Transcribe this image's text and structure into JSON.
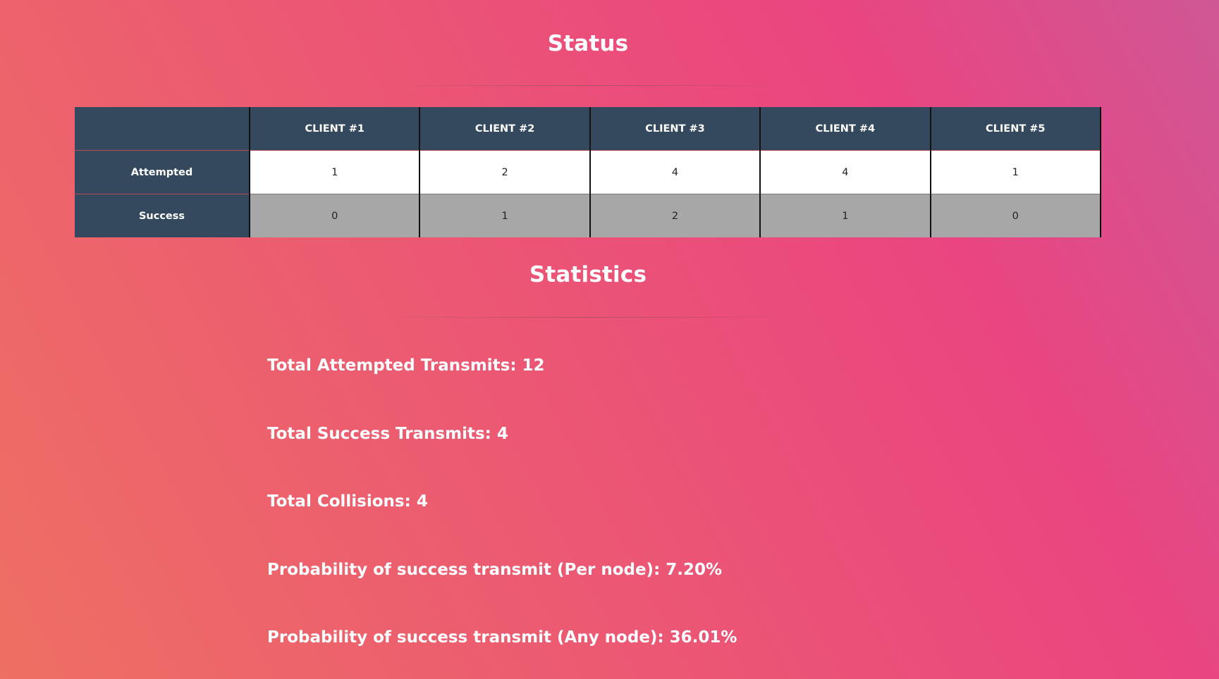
{
  "status": {
    "title": "Status",
    "table": {
      "corner": "",
      "columns": [
        "CLIENT #1",
        "CLIENT #2",
        "CLIENT #3",
        "CLIENT #4",
        "CLIENT #5"
      ],
      "rows": [
        {
          "label": "Attempted",
          "values": [
            "1",
            "2",
            "4",
            "4",
            "1"
          ]
        },
        {
          "label": "Success",
          "values": [
            "0",
            "1",
            "2",
            "1",
            "0"
          ]
        }
      ]
    }
  },
  "statistics": {
    "title": "Statistics",
    "lines": [
      "Total Attempted Transmits: 12",
      "Total Success Transmits: 4",
      "Total Collisions: 4",
      "Probability of success transmit (Per node): 7.20%",
      "Probability of success transmit (Any node): 36.01%"
    ]
  },
  "colors": {
    "table_header_bg": "#34495e",
    "attempted_row_bg": "#ffffff",
    "success_row_bg": "#a7a7a7",
    "background_gradient": [
      "#ee6f63",
      "#ea4580",
      "#cf5795"
    ]
  }
}
